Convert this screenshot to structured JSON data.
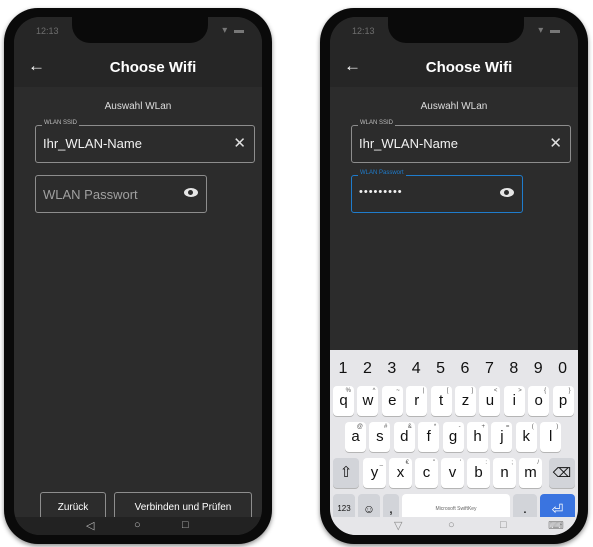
{
  "status_time": "12:13",
  "app": {
    "title": "Choose Wifi",
    "section_title": "Auswahl WLan"
  },
  "ssid": {
    "label": "WLAN SSID",
    "value": "Ihr_WLAN-Name"
  },
  "password": {
    "label": "WLAN Passwort",
    "placeholder": "WLAN Passwort",
    "masked_value": "•••••••••"
  },
  "buttons": {
    "back": "Zurück",
    "connect": "Verbinden und Prüfen"
  },
  "keyboard": {
    "numbers": [
      "1",
      "2",
      "3",
      "4",
      "5",
      "6",
      "7",
      "8",
      "9",
      "0"
    ],
    "row1": [
      {
        "k": "q",
        "s": "%"
      },
      {
        "k": "w",
        "s": "^"
      },
      {
        "k": "e",
        "s": "~"
      },
      {
        "k": "r",
        "s": "|"
      },
      {
        "k": "t",
        "s": "["
      },
      {
        "k": "z",
        "s": "]"
      },
      {
        "k": "u",
        "s": "<"
      },
      {
        "k": "i",
        "s": ">"
      },
      {
        "k": "o",
        "s": "{"
      },
      {
        "k": "p",
        "s": "}"
      }
    ],
    "row2": [
      {
        "k": "a",
        "s": "@"
      },
      {
        "k": "s",
        "s": "#"
      },
      {
        "k": "d",
        "s": "&"
      },
      {
        "k": "f",
        "s": "*"
      },
      {
        "k": "g",
        "s": "-"
      },
      {
        "k": "h",
        "s": "+"
      },
      {
        "k": "j",
        "s": "="
      },
      {
        "k": "k",
        "s": "("
      },
      {
        "k": "l",
        "s": ")"
      }
    ],
    "row3": [
      {
        "k": "y",
        "s": "_"
      },
      {
        "k": "x",
        "s": "€"
      },
      {
        "k": "c",
        "s": "\""
      },
      {
        "k": "v",
        "s": "'"
      },
      {
        "k": "b",
        "s": ":"
      },
      {
        "k": "n",
        "s": ";"
      },
      {
        "k": "m",
        "s": "/"
      }
    ],
    "sym_key": "123",
    "comma": ",",
    "period": ".",
    "space_label": "Microsoft SwiftKey",
    "shift_icon": "⇧",
    "backspace_icon": "⌫",
    "enter_icon": "⏎",
    "emoji_icon": "☺"
  }
}
